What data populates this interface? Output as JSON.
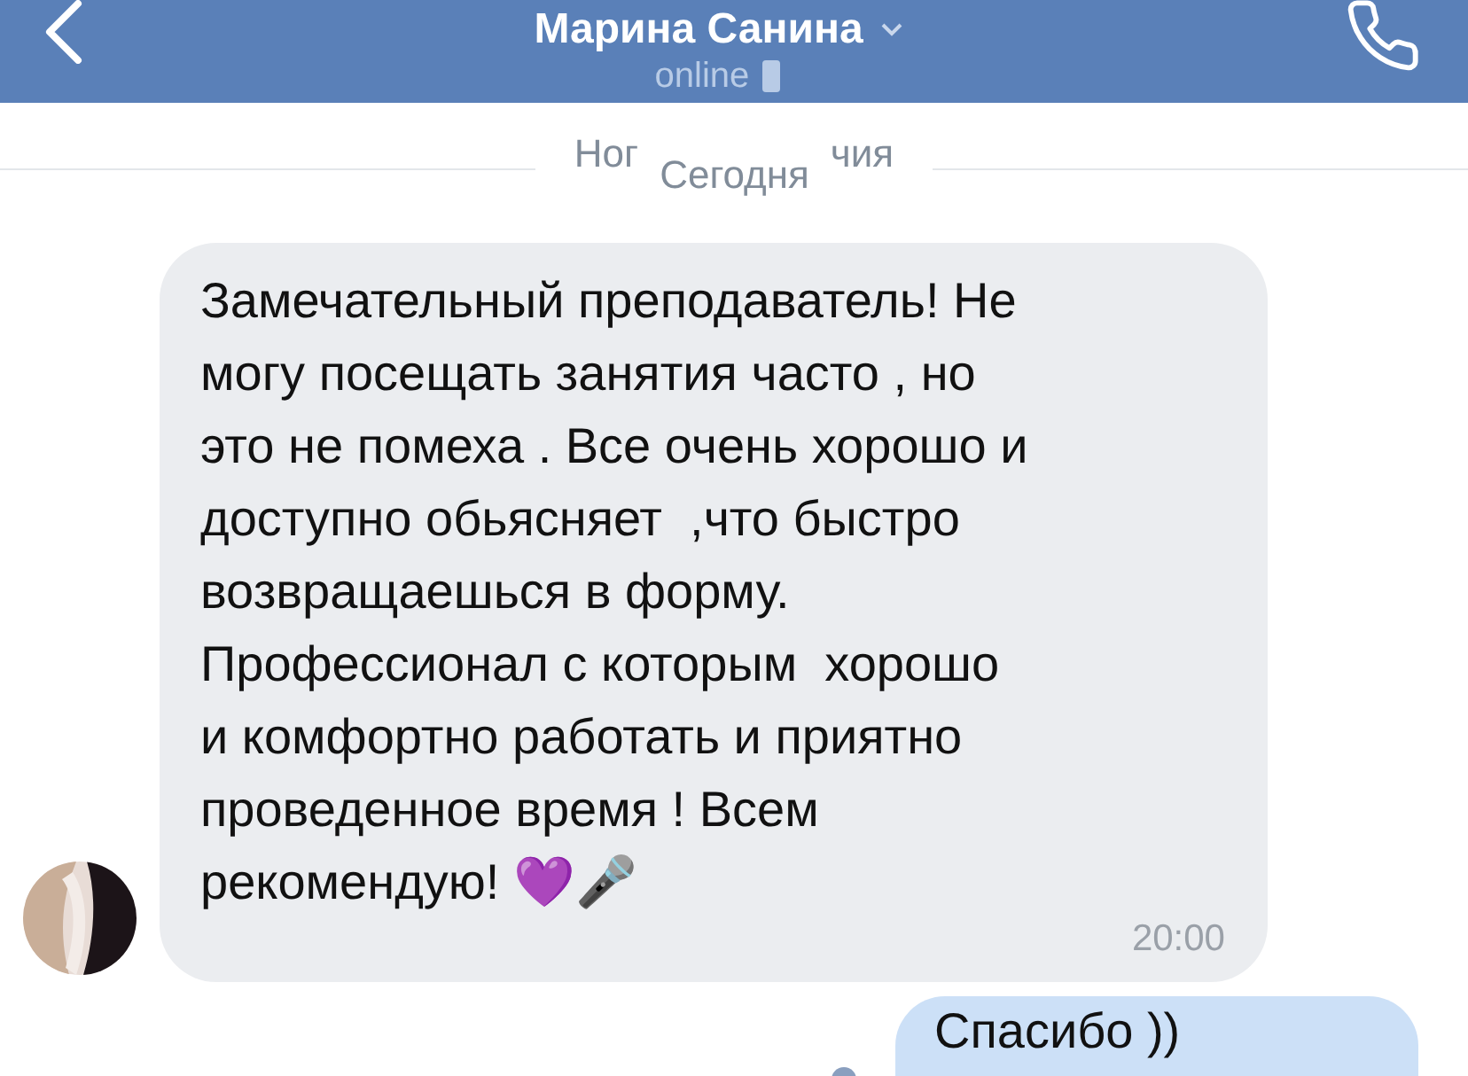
{
  "header": {
    "title": "Марина Санина",
    "status": "online"
  },
  "divider": {
    "fragment_left": "Ног",
    "label": "Сегодня",
    "fragment_right": "чия"
  },
  "messages": [
    {
      "kind": "incoming",
      "text": "Замечательный преподаватель! Не\nмогу посещать занятия часто , но\nэто не помеха . Все очень хорошо и\nдоступно обьясняет  ,что быстро\nвозвращаешься в форму.\nПрофессионал с которым  хорошо\nи комфортно работать и приятно\nпроведенное время ! Всем\nрекомендую! 💜🎤",
      "time": "20:00"
    },
    {
      "kind": "outgoing",
      "text": "Спасибо ))"
    }
  ]
}
